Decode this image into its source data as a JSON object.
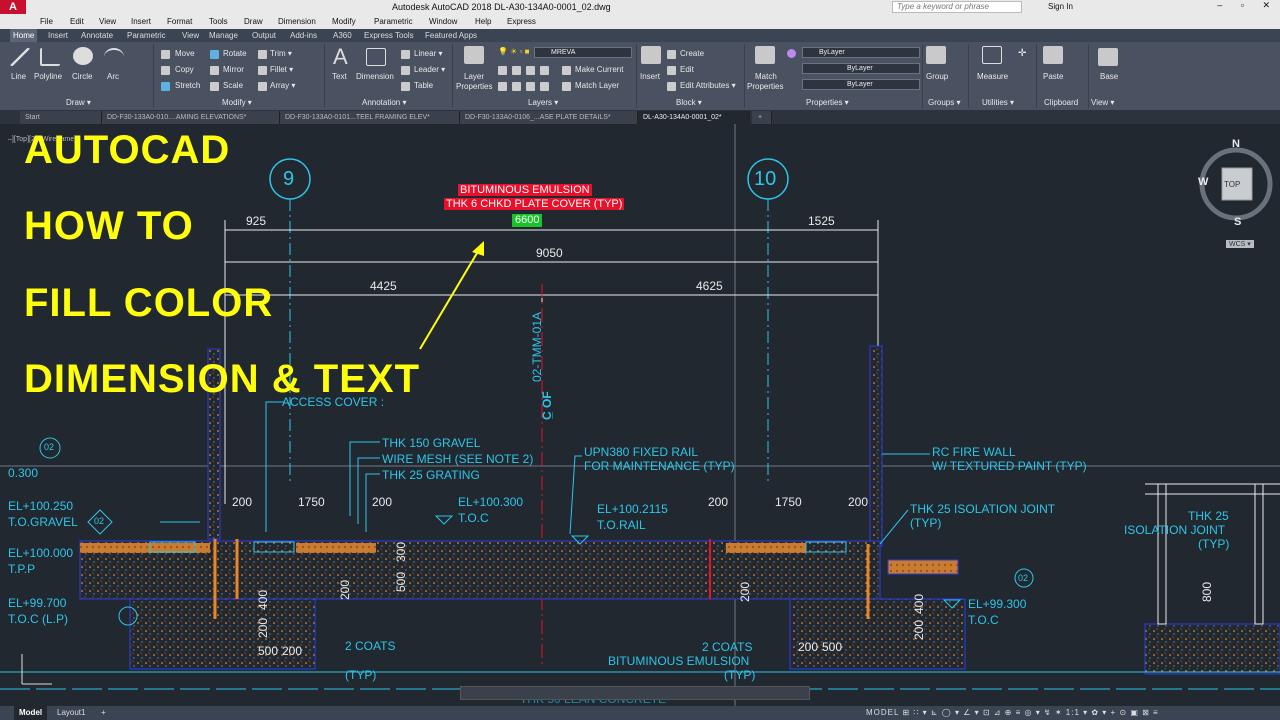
{
  "app": {
    "logo": "A",
    "title": "Autodesk AutoCAD 2018    DL-A30-134A0-0001_02.dwg",
    "search_placeholder": "Type a keyword or phrase",
    "signin": "Sign In",
    "window_controls": "–  ▫  ✕"
  },
  "menu": [
    "File",
    "Edit",
    "View",
    "Insert",
    "Format",
    "Tools",
    "Draw",
    "Dimension",
    "Modify",
    "Parametric",
    "Window",
    "Help",
    "Express"
  ],
  "ribbon_tabs": [
    "Home",
    "Insert",
    "Annotate",
    "Parametric",
    "View",
    "Manage",
    "Output",
    "Add-ins",
    "A360",
    "Express Tools",
    "Featured Apps"
  ],
  "ribbon": {
    "draw": {
      "line": "Line",
      "polyline": "Polyline",
      "circle": "Circle",
      "arc": "Arc",
      "panel": "Draw ▾"
    },
    "modify": {
      "move": "Move",
      "rotate": "Rotate",
      "trim": "Trim ▾",
      "copy": "Copy",
      "mirror": "Mirror",
      "fillet": "Fillet ▾",
      "stretch": "Stretch",
      "scale": "Scale",
      "array": "Array ▾",
      "panel": "Modify ▾"
    },
    "annotation": {
      "text": "Text",
      "dimension": "Dimension",
      "linear": "Linear ▾",
      "leader": "Leader ▾",
      "table": "Table",
      "panel": "Annotation ▾"
    },
    "layers": {
      "props1": "Layer",
      "props2": "Properties",
      "current_layer": "MREVA",
      "make_current": "Make Current",
      "match_layer": "Match Layer",
      "panel": "Layers ▾"
    },
    "block": {
      "insert": "Insert",
      "create": "Create",
      "edit": "Edit",
      "edit_attr": "Edit Attributes ▾",
      "panel": "Block ▾"
    },
    "properties": {
      "match1": "Match",
      "match2": "Properties",
      "color": "ByLayer",
      "linetype": "ByLayer",
      "lineweight": "ByLayer",
      "panel": "Properties ▾"
    },
    "groups": {
      "group": "Group",
      "panel": "Groups ▾"
    },
    "utilities": {
      "measure": "Measure",
      "panel": "Utilities ▾"
    },
    "clipboard": {
      "paste": "Paste",
      "panel": "Clipboard"
    },
    "view": {
      "base": "Base",
      "panel": "View ▾"
    }
  },
  "doc_tabs": [
    "Start",
    "DD-F30-133A0-010....AMING ELEVATIONS*",
    "DD-F30-133A0-0101...TEEL FRAMING ELEV*",
    "DD-F30-133A0-0106_...ASE PLATE DETAILS*",
    "DL-A30-134A0-0001_02*"
  ],
  "viewport_caption": "–][Top][2D Wireframe]",
  "overlay_lines": [
    "AUTOCAD",
    "HOW TO",
    "FILL COLOR",
    "DIMENSION & TEXT"
  ],
  "highlighted": {
    "line1": "BITUMINOUS EMULSION",
    "line2": "THK 6 CHKD PLATE COVER (TYP)",
    "dim": "6600"
  },
  "grid": {
    "g9": "9",
    "g10": "10"
  },
  "dims": {
    "d925": "925",
    "d1525": "1525",
    "d9050": "9050",
    "d4425": "4425",
    "d4625": "4625",
    "d200a": "200",
    "d1750a": "1750",
    "d200b": "200",
    "d200c": "200",
    "d1750b": "1750",
    "d200d": "200",
    "d300": "300",
    "d500": "500",
    "d200e": "200",
    "d400a": "400",
    "d200f": "200",
    "d500b": "500",
    "d200g": "200",
    "d200h": "200",
    "d500c": "500",
    "d200i": "200",
    "d400b": "400",
    "d200j": "200",
    "d800": "800"
  },
  "labels": {
    "access": "ACCESS COVER :",
    "gravel": "THK 150 GRAVEL",
    "wiremesh": "WIRE MESH (SEE NOTE 2)",
    "grating": "THK 25 GRATING",
    "upn1": "UPN380 FIXED RAIL",
    "upn2": "FOR MAINTENANCE (TYP)",
    "fire1": "RC FIRE WALL",
    "fire2": "W/ TEXTURED PAINT (TYP)",
    "el300": "EL+100.300",
    "toc": "T.O.C",
    "el2115": "EL+100.2115",
    "torail": "T.O.RAIL",
    "iso1": "THK 25 ISOLATION JOINT",
    "iso1b": "(TYP)",
    "iso2a": "THK 25",
    "iso2b": "ISOLATION JOINT",
    "iso2c": "(TYP)",
    "coats1": "2 COATS",
    "typ1": "(TYP)",
    "coats2": "2 COATS",
    "bitum": "BITUMINOUS EMULSION",
    "typ2": "(TYP)",
    "el99300": "EL+99.300",
    "toc2": "T.O.C",
    "cl": "C̲ OF",
    "clname": "02-TMM-01A",
    "left1": "0.300",
    "left2": "EL+100.250",
    "left3": "T.O.GRAVEL",
    "left4": "EL+100.000",
    "left5": "T.P.P",
    "left6": "EL+99.700",
    "left7": "T.O.C (L.P)",
    "lean": "THK 50 LEAN CONCRETE",
    "tag02": "02"
  },
  "viewcube": {
    "n": "N",
    "s": "S",
    "w": "W",
    "top": "TOP",
    "wcs": "WCS ▾"
  },
  "status": {
    "model": "Model",
    "layout1": "Layout1",
    "plus": "+",
    "right": "MODEL  ⊞ ∷ ▾ ⊾ ◯ ▾ ∠ ▾ ⊡ ⊿ ⊕ ≡ ◎ ▾ ↯ ✶ 1:1 ▾ ✿ ▾ + ⊙ ▣ ⊠ ≡"
  },
  "colors": {
    "cyan": "#2ec5e8",
    "yellow": "#ffff0c",
    "red": "#e8102a",
    "green": "#19c42a",
    "orange": "#e8862a",
    "blue": "#2a3be8"
  }
}
